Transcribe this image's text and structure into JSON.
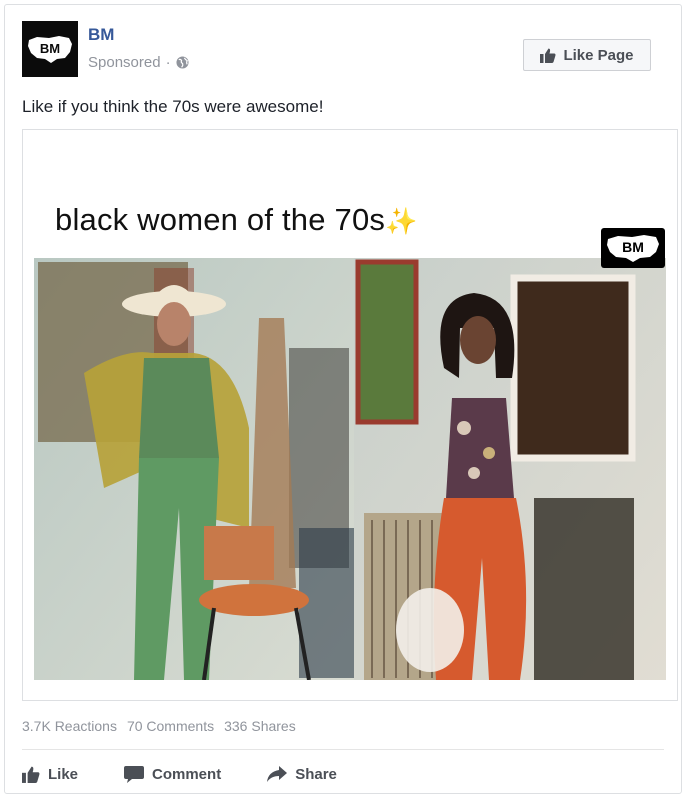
{
  "post": {
    "page_name": "BM",
    "sponsored_label": "Sponsored",
    "separator": "·",
    "avatar_text": "BM",
    "like_page_label": "Like Page",
    "text": "Like if you think the 70s were awesome!"
  },
  "media": {
    "caption": "black women of the 70s",
    "sparkle": "✨",
    "watermark": "BM"
  },
  "stats": {
    "reactions": "3.7K Reactions",
    "comments": "70 Comments",
    "shares": "336 Shares"
  },
  "actions": {
    "like": "Like",
    "comment": "Comment",
    "share": "Share"
  },
  "colors": {
    "link_blue": "#365899",
    "meta_gray": "#90949c",
    "action_gray": "#4b4f56",
    "border": "#dddfe2"
  }
}
